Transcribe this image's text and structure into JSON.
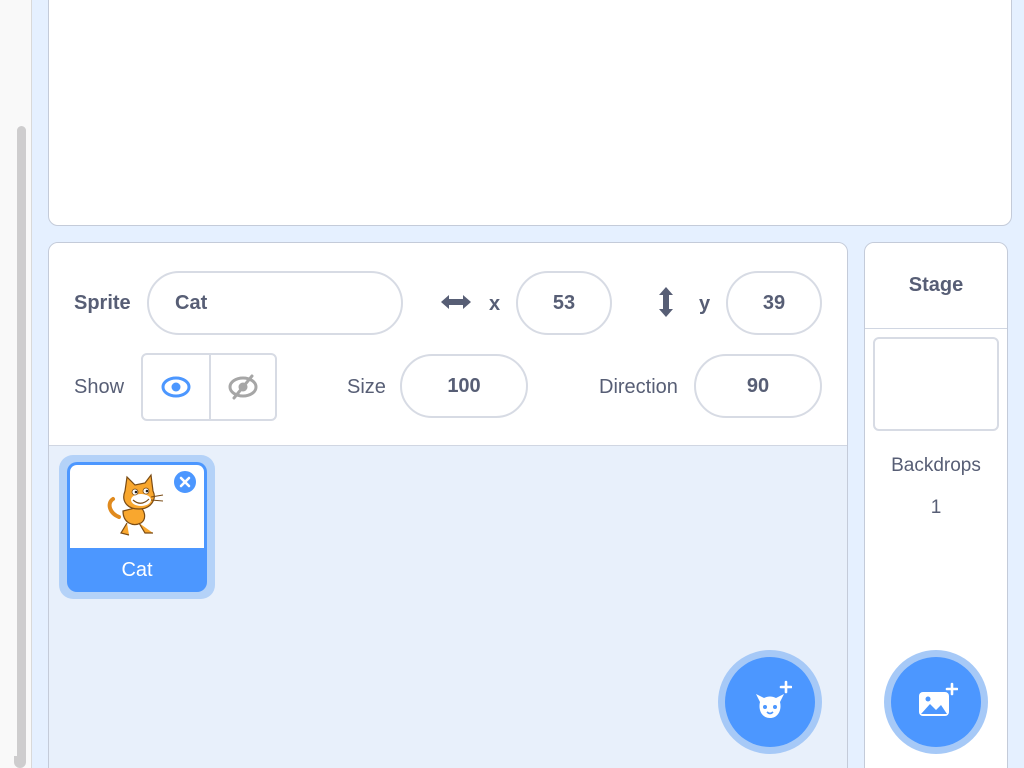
{
  "sprite_info": {
    "sprite_label": "Sprite",
    "sprite_name": "Cat",
    "x_label": "x",
    "x_value": "53",
    "y_label": "y",
    "y_value": "39",
    "show_label": "Show",
    "size_label": "Size",
    "size_value": "100",
    "direction_label": "Direction",
    "direction_value": "90"
  },
  "sprites": [
    {
      "name": "Cat",
      "selected": true
    }
  ],
  "stage": {
    "header": "Stage",
    "backdrops_label": "Backdrops",
    "backdrops_count": "1"
  },
  "icons": {
    "x_arrow": "horizontal-arrows-icon",
    "y_arrow": "vertical-arrows-icon",
    "show": "eye-icon",
    "hide": "eye-slash-icon",
    "delete": "close-icon",
    "add_sprite": "add-sprite-icon",
    "add_backdrop": "add-backdrop-icon"
  },
  "colors": {
    "accent": "#4c97ff",
    "text": "#575e75",
    "panel_bg": "#e8f0fb",
    "border": "#c4cbd9"
  }
}
